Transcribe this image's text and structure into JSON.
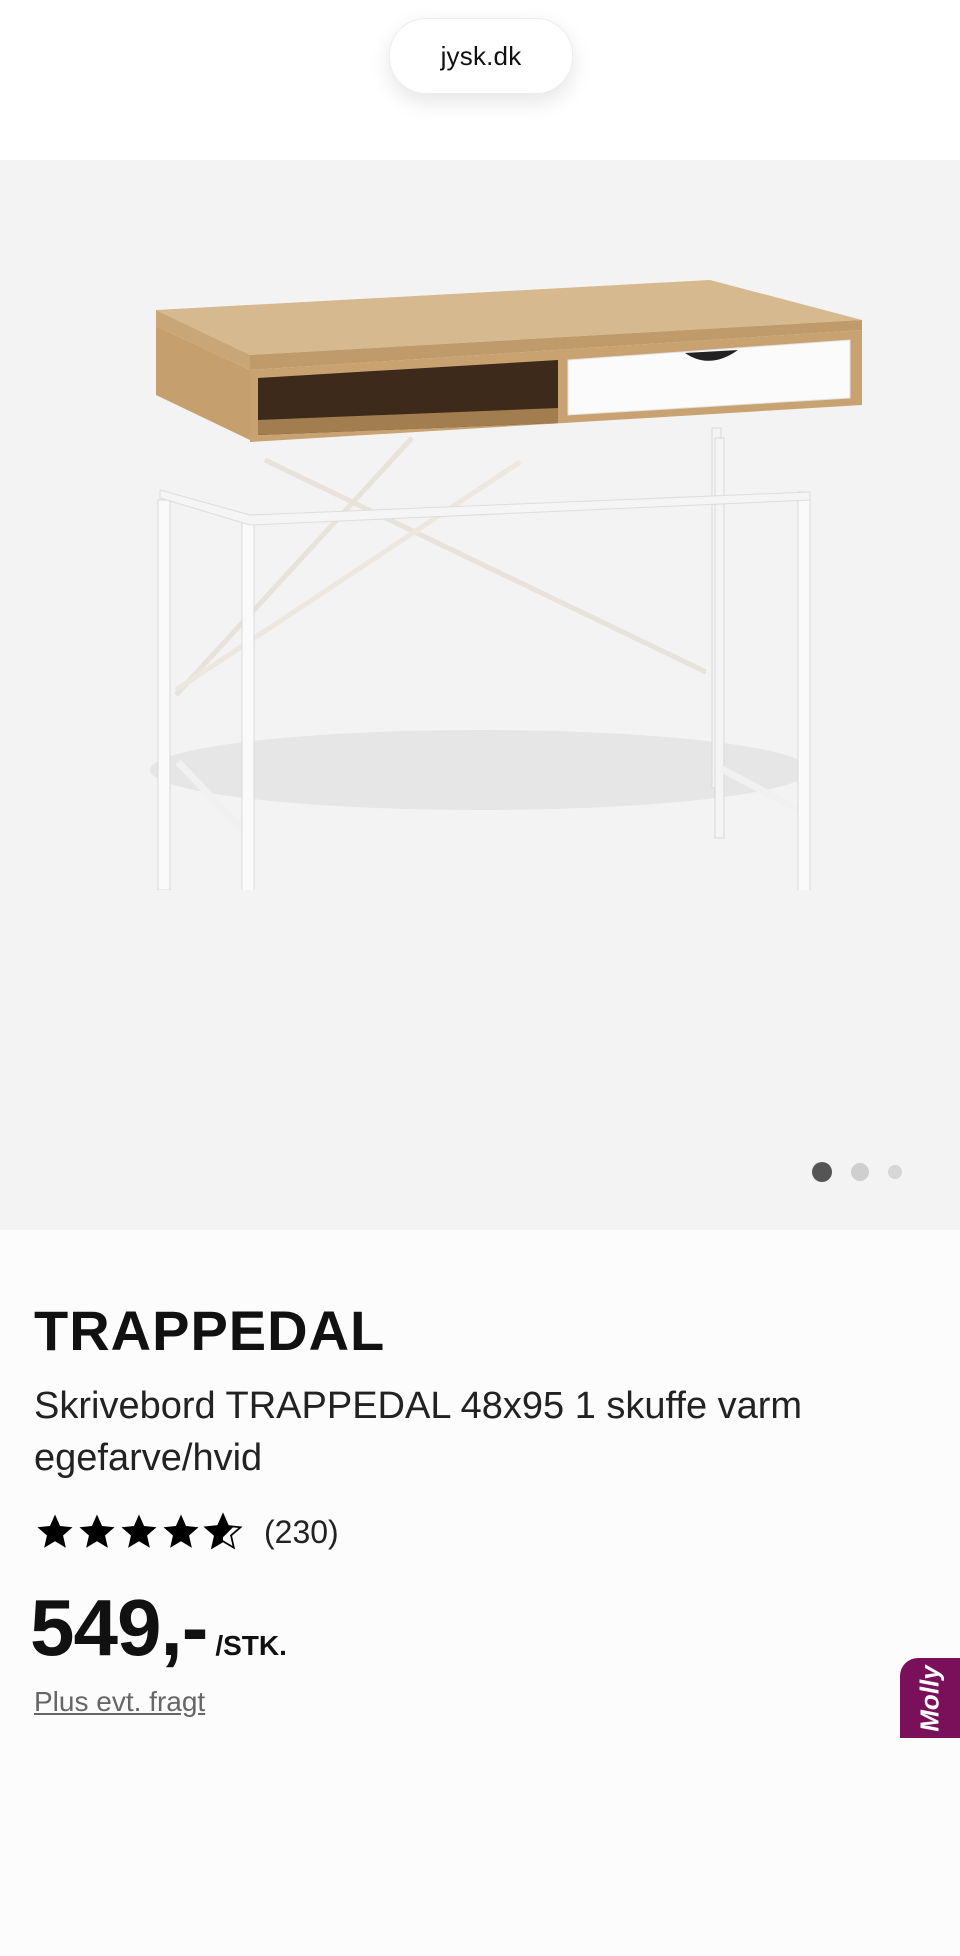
{
  "browser": {
    "url": "jysk.dk"
  },
  "gallery": {
    "image_name": "desk-product-photo",
    "slide_count": 3,
    "active_slide": 1
  },
  "product": {
    "brand": "TRAPPEDAL",
    "description": "Skrivebord TRAPPEDAL 48x95 1 skuffe varm egefarve/hvid",
    "rating": {
      "stars": 4.5,
      "max_stars": 5,
      "review_count": "(230)"
    },
    "price": "549,-",
    "unit": "/STK.",
    "freight_link": "Plus evt. fragt"
  },
  "chat_widget": {
    "label": "Molly"
  },
  "colors": {
    "gallery_bg": "#f3f3f3",
    "chat_tab": "#7a0f5a",
    "wood": "#d6b98f"
  }
}
